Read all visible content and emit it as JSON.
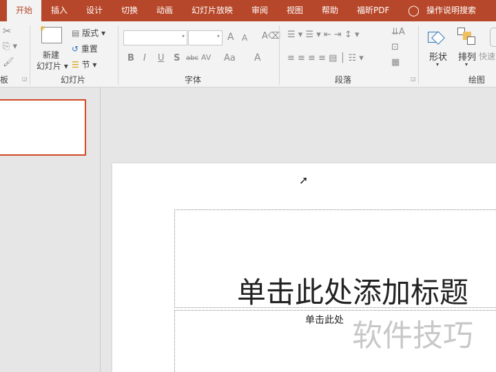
{
  "tabs": [
    "开始",
    "插入",
    "设计",
    "切换",
    "动画",
    "幻灯片放映",
    "审阅",
    "视图",
    "帮助",
    "福昕PDF"
  ],
  "search_label": "操作说明搜索",
  "ribbon": {
    "clipboard_label": "板",
    "new_slide_line1": "新建",
    "new_slide_line2": "幻灯片",
    "layout": "版式",
    "reset": "重置",
    "section": "节",
    "slides_group": "幻灯片",
    "font_group": "字体",
    "font_buttons": [
      "B",
      "I",
      "U",
      "S",
      "abc",
      "AV",
      "Aa",
      "A"
    ],
    "font_grow": "A",
    "font_shrink": "A",
    "paragraph_group": "段落",
    "shapes": "形状",
    "arrange": "排列",
    "quick": "快速",
    "drawing_group": "绘图"
  },
  "slide": {
    "title_placeholder": "单击此处添加标题",
    "subtitle_placeholder": "单击此处"
  },
  "watermark": "软件技巧"
}
